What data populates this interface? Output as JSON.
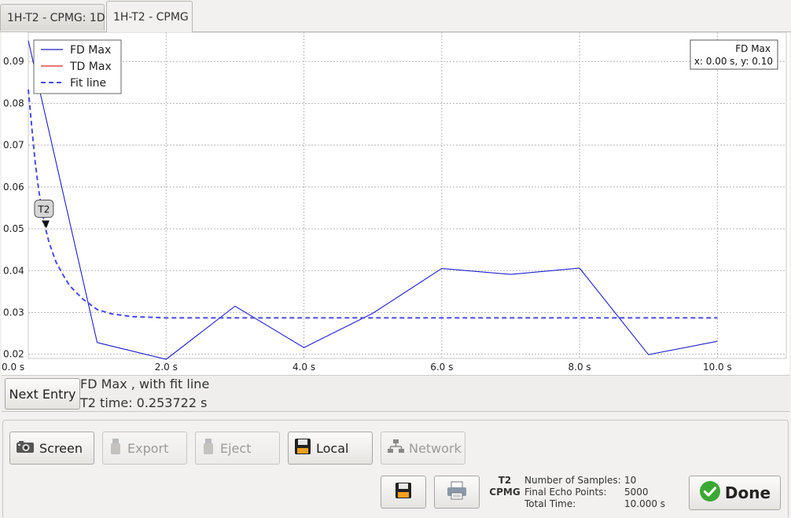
{
  "tabs": [
    {
      "label": "1H-T2 - CPMG: 1D",
      "active": false
    },
    {
      "label": "1H-T2 - CPMG",
      "active": true
    }
  ],
  "chart_data": {
    "type": "line",
    "x_tick_labels": [
      "0.0 s",
      "2.0 s",
      "4.0 s",
      "6.0 s",
      "8.0 s",
      "10.0 s"
    ],
    "y_tick_labels": [
      "0.02",
      "0.03",
      "0.04",
      "0.05",
      "0.06",
      "0.07",
      "0.08",
      "0.09"
    ],
    "xlim": [
      0,
      11
    ],
    "ylim": [
      0.019,
      0.097
    ],
    "grid": true,
    "legend_position": "top-left",
    "series": [
      {
        "name": "FD Max",
        "color": "#1f1fcf",
        "style": "solid",
        "x": [
          0,
          1,
          2,
          3,
          4,
          5,
          6,
          7,
          8,
          9,
          10
        ],
        "y": [
          0.095,
          0.0228,
          0.0188,
          0.0315,
          0.0216,
          0.0298,
          0.0405,
          0.0391,
          0.0406,
          0.0199,
          0.0231
        ]
      },
      {
        "name": "TD Max",
        "color": "#e02020",
        "style": "solid",
        "x": [],
        "y": []
      },
      {
        "name": "Fit line",
        "color": "#4a4ae6",
        "style": "dashed",
        "x": [
          0,
          0.05,
          0.1,
          0.15,
          0.2,
          0.25,
          0.3,
          0.4,
          0.5,
          0.6,
          0.7,
          0.8,
          1.0,
          1.2,
          1.5,
          2.0,
          3.0,
          4.0,
          5.0,
          6.0,
          7.0,
          8.0,
          9.0,
          10.0
        ],
        "y": [
          0.0833,
          0.0743,
          0.0659,
          0.0594,
          0.0542,
          0.0501,
          0.0468,
          0.0421,
          0.0391,
          0.0364,
          0.0347,
          0.0331,
          0.0307,
          0.0297,
          0.029,
          0.0287,
          0.0287,
          0.0287,
          0.0287,
          0.0287,
          0.0287,
          0.0287,
          0.0287,
          0.0287
        ]
      }
    ],
    "annotation": {
      "label": "T2",
      "x": 0.25,
      "y": 0.0501
    },
    "cursor_readout": {
      "title": "FD Max",
      "text": "x: 0.00 s, y: 0.10"
    }
  },
  "info": {
    "next_entry_label": "Next Entry",
    "line1": "FD Max , with fit line",
    "line2": "T2 time: 0.253722 s"
  },
  "toolbar": {
    "screen_label": "Screen",
    "export_label": "Export",
    "eject_label": "Eject",
    "local_label": "Local",
    "network_label": "Network",
    "done_label": "Done"
  },
  "stats": {
    "tag_line1": "T2",
    "tag_line2": "CPMG",
    "samples_label": "Number of Samples:",
    "samples_value": "10",
    "echo_label": "Final Echo Points:",
    "echo_value": "5000",
    "time_label": "Total Time:",
    "time_value": "10.000 s"
  }
}
